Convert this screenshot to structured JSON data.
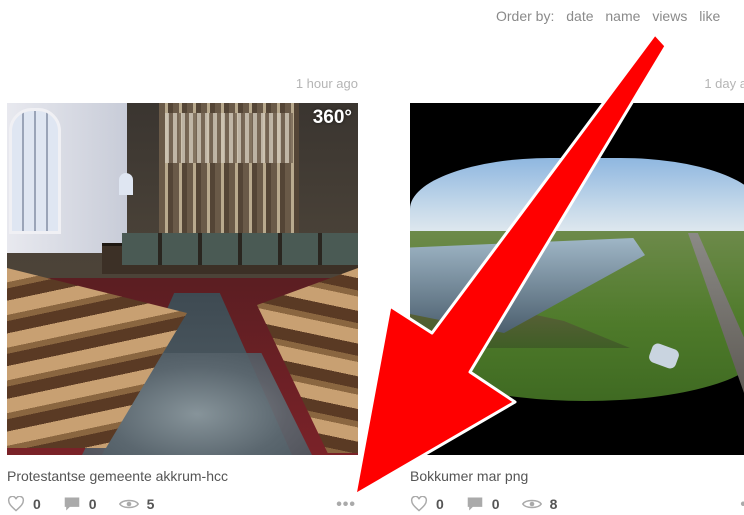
{
  "order": {
    "label": "Order by:",
    "options": [
      "date",
      "name",
      "views",
      "like"
    ]
  },
  "cards": [
    {
      "time": "1 hour ago",
      "badge": "360°",
      "title": "Protestantse gemeente akkrum-hcc",
      "likes": "0",
      "comments": "0",
      "views": "5",
      "more": "•••"
    },
    {
      "time": "1 day a",
      "title": "Bokkumer mar png",
      "likes": "0",
      "comments": "0",
      "views": "8",
      "more": "•"
    }
  ],
  "colors": {
    "arrow": "#ff0000",
    "text_muted": "#8a8a8a",
    "icon_gray": "#aaaaaa"
  }
}
